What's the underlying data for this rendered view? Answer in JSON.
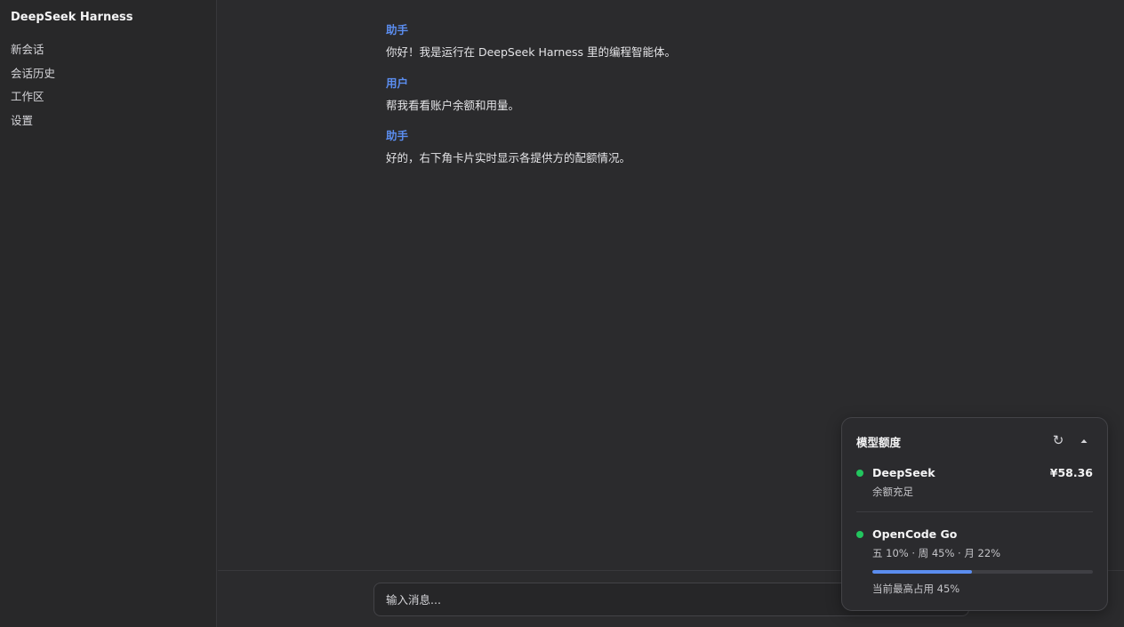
{
  "sidebar": {
    "app_title": "DeepSeek Harness",
    "items": [
      {
        "label": "新会话"
      },
      {
        "label": "会话历史"
      },
      {
        "label": "工作区"
      },
      {
        "label": "设置"
      }
    ]
  },
  "messages": [
    {
      "role": "助手",
      "text": "你好！我是运行在 DeepSeek Harness 里的编程智能体。"
    },
    {
      "role": "用户",
      "text": "帮我看看账户余额和用量。"
    },
    {
      "role": "助手",
      "text": "好的，右下角卡片实时显示各提供方的配额情况。"
    }
  ],
  "composer": {
    "placeholder": "输入消息..."
  },
  "quota_card": {
    "title": "模型额度",
    "refresh_icon": "refresh-icon",
    "collapse_icon": "chevron-up-icon",
    "providers": [
      {
        "name": "DeepSeek",
        "balance": "¥58.36",
        "status": "余额充足",
        "status_color": "#22c55e"
      },
      {
        "name": "OpenCode Go",
        "usage": "五 10% · 周 45% · 月 22%",
        "status_color": "#22c55e",
        "progress_percent": 45,
        "progress_caption": "当前最高占用 45%"
      }
    ]
  },
  "colors": {
    "accent": "#5b8def",
    "status_ok": "#22c55e",
    "background": "#2b2b2d"
  }
}
